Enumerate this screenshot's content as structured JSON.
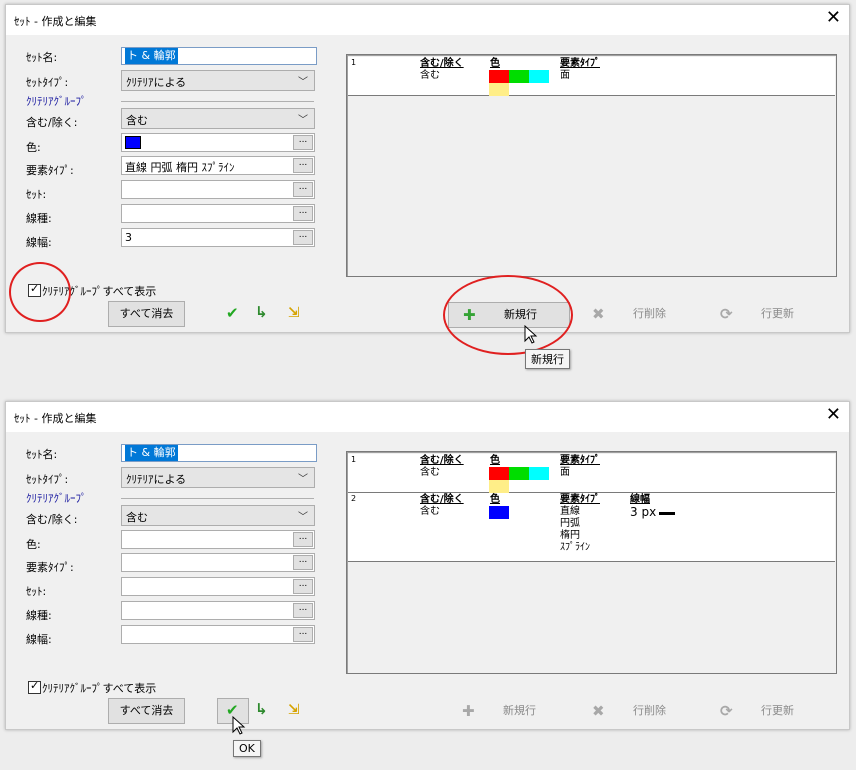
{
  "dialog1": {
    "title": "ｾｯﾄ - 作成と編集",
    "labels": {
      "set_name": "ｾｯﾄ名:",
      "set_type": "ｾｯﾄﾀｲﾌﾟ:",
      "criteria_group": "ｸﾘﾃﾘｱｸﾞﾙｰﾌﾟ",
      "include_exclude": "含む/除く:",
      "color": "色:",
      "element_type": "要素ﾀｲﾌﾟ:",
      "set": "ｾｯﾄ:",
      "line_type": "線種:",
      "line_width": "線幅:"
    },
    "set_name_value": "ト & 輪郭",
    "set_type_value": "ｸﾘﾃﾘｱによる",
    "include_value": "含む",
    "element_type_value": "直線 円弧 楕円 ｽﾌﾟﾗｲﾝ",
    "line_width_value": "3",
    "color_value": "#0000ff",
    "show_all_label": "ｸﾘﾃﾘｱｸﾞﾙｰﾌﾟすべて表示",
    "show_all_checked": true,
    "clear_all": "すべて消去",
    "new_row": "新規行",
    "delete_row": "行削除",
    "update_row": "行更新",
    "tooltip": "新規行",
    "rows": [
      {
        "num": "1",
        "h_inc": "含む/除く",
        "inc": "含む",
        "h_color": "色",
        "h_type": "要素ﾀｲﾌﾟ",
        "type": "面"
      }
    ]
  },
  "dialog2": {
    "title": "ｾｯﾄ - 作成と編集",
    "labels": {
      "set_name": "ｾｯﾄ名:",
      "set_type": "ｾｯﾄﾀｲﾌﾟ:",
      "criteria_group": "ｸﾘﾃﾘｱｸﾞﾙｰﾌﾟ",
      "include_exclude": "含む/除く:",
      "color": "色:",
      "element_type": "要素ﾀｲﾌﾟ:",
      "set": "ｾｯﾄ:",
      "line_type": "線種:",
      "line_width": "線幅:"
    },
    "set_name_value": "ト & 輪郭",
    "set_type_value": "ｸﾘﾃﾘｱによる",
    "include_value": "含む",
    "show_all_label": "ｸﾘﾃﾘｱｸﾞﾙｰﾌﾟすべて表示",
    "show_all_checked": true,
    "clear_all": "すべて消去",
    "new_row": "新規行",
    "delete_row": "行削除",
    "update_row": "行更新",
    "tooltip": "OK",
    "rows": [
      {
        "num": "1",
        "h_inc": "含む/除く",
        "inc": "含む",
        "h_color": "色",
        "h_type": "要素ﾀｲﾌﾟ",
        "type": "面"
      },
      {
        "num": "2",
        "h_inc": "含む/除く",
        "inc": "含む",
        "h_color": "色",
        "h_type": "要素ﾀｲﾌﾟ",
        "types": [
          "直線",
          "円弧",
          "楕円",
          "ｽﾌﾟﾗｲﾝ"
        ],
        "h_width": "線幅",
        "width": "3 px"
      }
    ]
  },
  "colors": {
    "red": "#ff0000",
    "green": "#00dd00",
    "cyan": "#00ffff",
    "yellow": "#ffee88",
    "blue": "#0000ff",
    "annotation": "#e02020",
    "selection": "#0078d7"
  },
  "icons": {
    "close": "close-icon",
    "ok": "check-icon",
    "apply": "check-arrow-icon",
    "export": "export-icon",
    "plus": "plus-icon",
    "delete": "x-icon",
    "refresh": "refresh-icon"
  }
}
